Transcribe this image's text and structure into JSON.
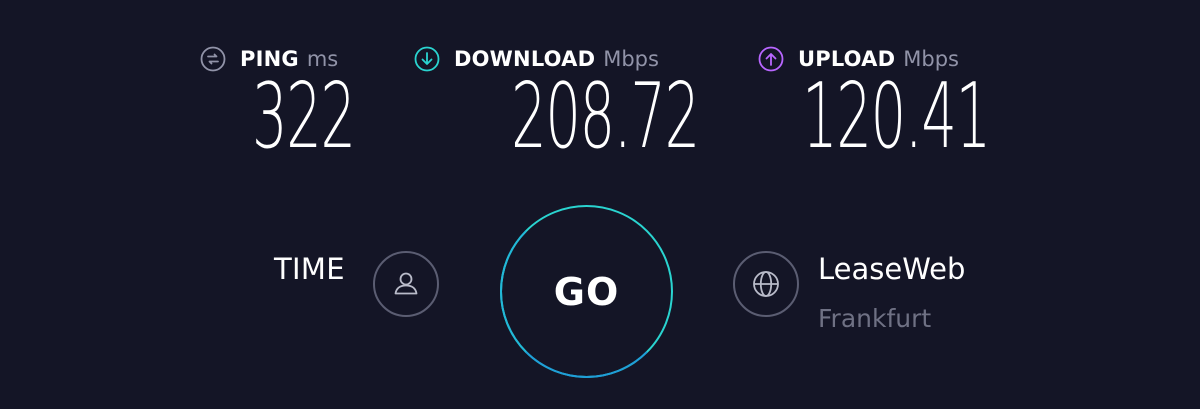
{
  "metrics": {
    "ping": {
      "label": "PING",
      "unit": "ms",
      "value": "322",
      "icon": "ping-icon",
      "color": "#9193a8"
    },
    "download": {
      "label": "DOWNLOAD",
      "unit": "Mbps",
      "value": "208.72",
      "icon": "download-arrow-icon",
      "color": "#2ad4d0"
    },
    "upload": {
      "label": "UPLOAD",
      "unit": "Mbps",
      "value": "120.41",
      "icon": "upload-arrow-icon",
      "color": "#b866ff"
    }
  },
  "provider": {
    "label": "TIME",
    "icon": "user-icon"
  },
  "go_button": {
    "label": "GO",
    "color": "#2ad4d0"
  },
  "server": {
    "name": "LeaseWeb",
    "location": "Frankfurt",
    "icon": "globe-icon"
  },
  "colors": {
    "background": "#141526",
    "muted": "#6f7184"
  }
}
